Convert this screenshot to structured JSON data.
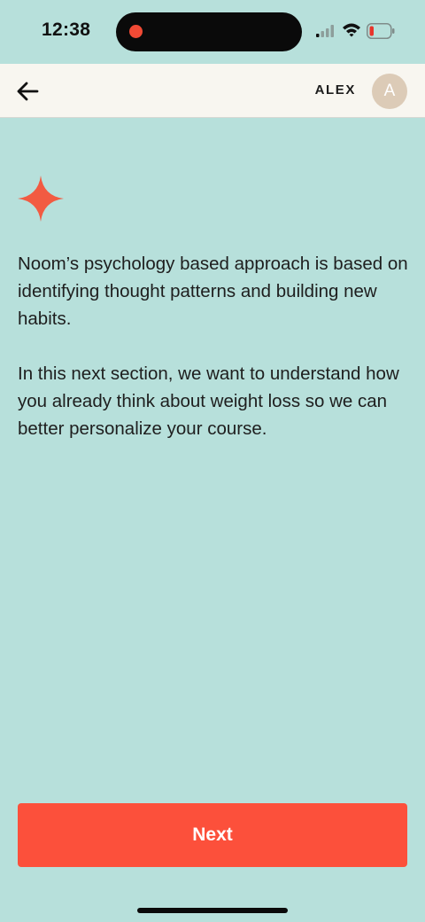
{
  "status_bar": {
    "time": "12:38",
    "icons": [
      "signal-icon",
      "wifi-icon",
      "battery-low-icon"
    ],
    "recording_color": "#f04a35"
  },
  "header": {
    "back_icon": "arrow-left-icon",
    "user_name": "ALEX",
    "avatar_initial": "A",
    "avatar_color": "#dccbb7"
  },
  "main": {
    "icon": "sparkle-icon",
    "accent_color": "#f25b42",
    "paragraphs": [
      "Noom’s psychology based approach is based on identifying thought patterns and building new habits.",
      "In this next section, we want to understand how you already think about weight loss so we can better personalize your course."
    ]
  },
  "footer": {
    "next_label": "Next",
    "button_color": "#fc503b"
  },
  "colors": {
    "background": "#b7e0db",
    "header_background": "#f8f6f0"
  }
}
